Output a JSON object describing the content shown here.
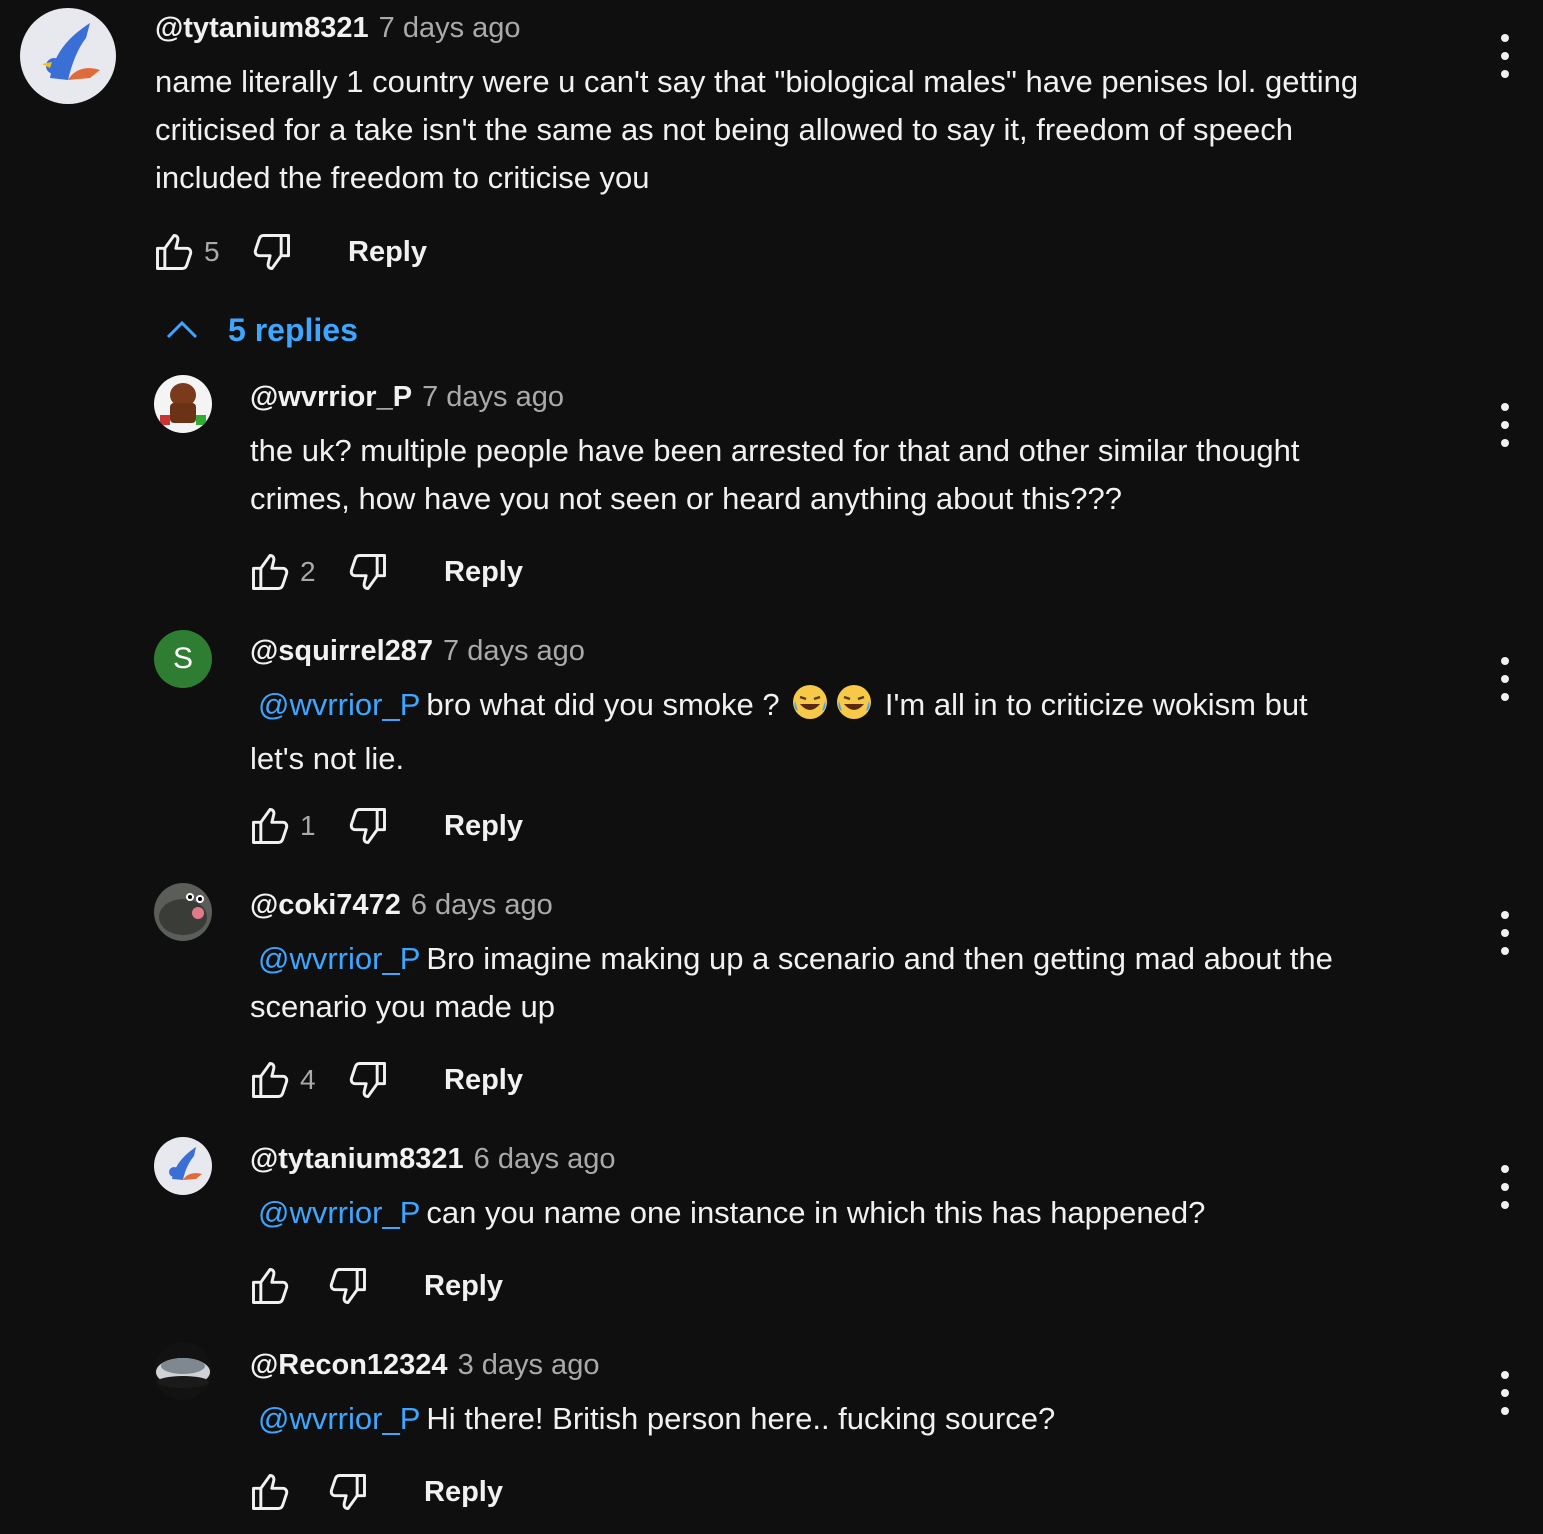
{
  "top_comment": {
    "handle": "@tytanium8321",
    "time": "7 days ago",
    "text_line1": "name literally 1 country were u can't say that \"biological males\" have penises lol. getting",
    "text_line2": "criticised for a take isn't the same as not being allowed to say it, freedom of speech",
    "text_line3": "included the freedom to criticise you",
    "likes": "5",
    "reply_label": "Reply"
  },
  "replies_toggle": {
    "label": "5 replies"
  },
  "replies": [
    {
      "handle": "@wvrrior_P",
      "time": "7 days ago",
      "mention": "",
      "line1": "the uk? multiple people have been arrested for that and other similar thought",
      "line2": "crimes, how have you not seen or heard anything about this???",
      "likes": "2",
      "reply_label": "Reply"
    },
    {
      "handle": "@squirrel287",
      "avatar_letter": "S",
      "time": "7 days ago",
      "mention": "@wvrrior_P",
      "line1_a": "bro what did you smoke ?",
      "line1_b": "I'm all in to criticize wokism but",
      "line2": "let's not lie.",
      "likes": "1",
      "reply_label": "Reply"
    },
    {
      "handle": "@coki7472",
      "time": "6 days ago",
      "mention": "@wvrrior_P",
      "line1": "Bro imagine making up a scenario and then getting mad about the",
      "line2": "scenario you made up",
      "likes": "4",
      "reply_label": "Reply"
    },
    {
      "handle": "@tytanium8321",
      "time": "6 days ago",
      "mention": "@wvrrior_P",
      "line1": "can you name one instance in which this has happened?",
      "likes": "",
      "reply_label": "Reply"
    },
    {
      "handle": "@Recon12324",
      "time": "3 days ago",
      "mention": "@wvrrior_P",
      "line1": "Hi there! British person here.. fucking source?",
      "likes": "",
      "reply_label": "Reply"
    }
  ],
  "colors": {
    "background": "#0f0f0f",
    "link": "#3ea6ff",
    "muted": "#aaaaaa",
    "text": "#f1f1f1",
    "avatar_green": "#2e7d32"
  }
}
